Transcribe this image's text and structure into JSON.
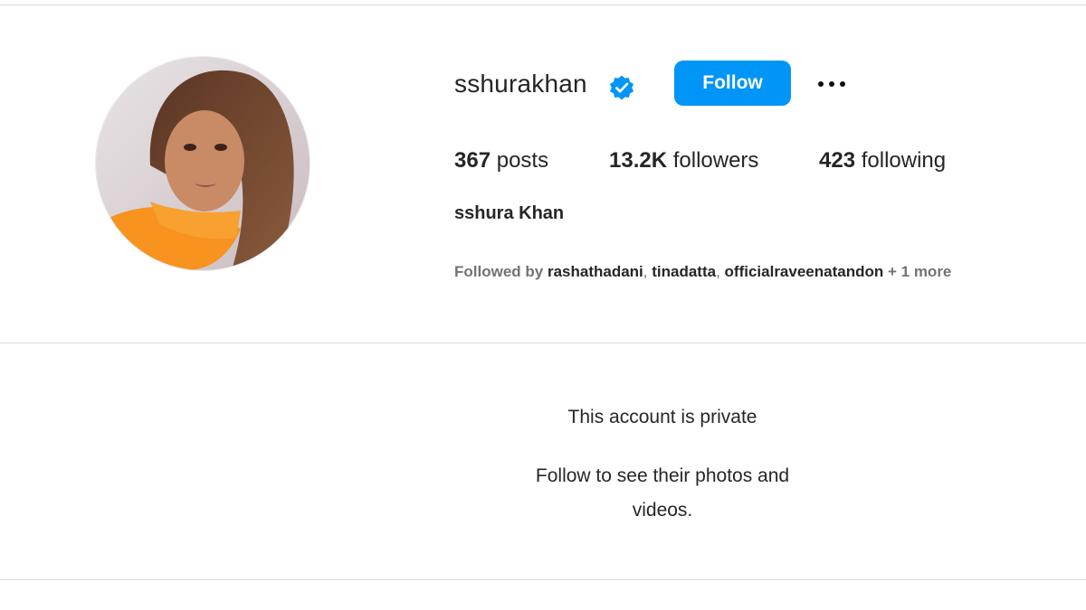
{
  "profile": {
    "username": "sshurakhan",
    "full_name": "sshura Khan",
    "verified": true,
    "avatar_icon": "profile-photo"
  },
  "actions": {
    "follow_label": "Follow",
    "more_icon": "more-horizontal-icon"
  },
  "stats": {
    "posts_count": "367",
    "posts_label": "posts",
    "followers_count": "13.2K",
    "followers_label": "followers",
    "following_count": "423",
    "following_label": "following"
  },
  "followed_by": {
    "label": "Followed by",
    "users": [
      "rashathadani",
      "tinadatta",
      "officialraveenatandon"
    ],
    "more": "+ 1 more"
  },
  "private_notice": {
    "title": "This account is private",
    "subtitle": "Follow to see their photos and videos."
  },
  "colors": {
    "accent": "#0095f6",
    "divider": "#dbdbdb",
    "secondary_text": "#737373"
  }
}
